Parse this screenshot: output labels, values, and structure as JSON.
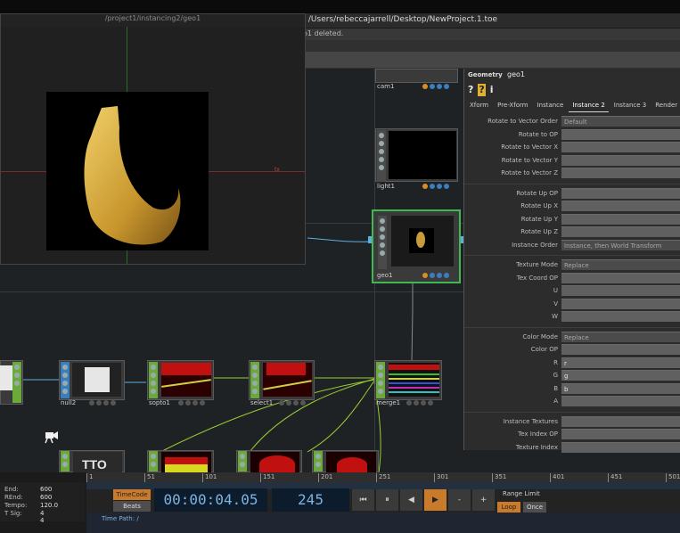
{
  "title_bar": {
    "path": ": /Users/rebeccajarrell/Desktop/NewProject.1.toe"
  },
  "message_bar": {
    "text": "o1 deleted."
  },
  "viewer": {
    "title": "/project1/instancing2/geo1",
    "axis_label": "tx"
  },
  "nodes": {
    "cam1": "cam1",
    "light1": "light1",
    "geo1": "geo1",
    "null2": "null2",
    "sopto1": "sopto1",
    "select1": "select1",
    "merge1": "merge1",
    "text_top": "TTO"
  },
  "params": {
    "op_type": "Geometry",
    "op_name": "geo1",
    "icons": [
      "?",
      "?",
      "i"
    ],
    "tabs": [
      "Xform",
      "Pre-Xform",
      "Instance",
      "Instance 2",
      "Instance 3",
      "Render",
      "E"
    ],
    "active_tab": "Instance 2",
    "rows": [
      {
        "label": "Rotate to Vector Order",
        "value": "Default",
        "dropdown": true
      },
      {
        "label": "Rotate to OP",
        "value": ""
      },
      {
        "label": "Rotate to Vector X",
        "value": ""
      },
      {
        "label": "Rotate to Vector Y",
        "value": ""
      },
      {
        "label": "Rotate to Vector Z",
        "value": ""
      },
      {
        "label": "Rotate Up OP",
        "value": ""
      },
      {
        "label": "Rotate Up X",
        "value": ""
      },
      {
        "label": "Rotate Up Y",
        "value": ""
      },
      {
        "label": "Rotate Up Z",
        "value": ""
      },
      {
        "label": "Instance Order",
        "value": "Instance, then World Transform",
        "dropdown": true
      },
      {
        "label": "Texture Mode",
        "value": "Replace",
        "dropdown": true
      },
      {
        "label": "Tex Coord OP",
        "value": ""
      },
      {
        "label": "U",
        "value": ""
      },
      {
        "label": "V",
        "value": ""
      },
      {
        "label": "W",
        "value": ""
      },
      {
        "label": "Color Mode",
        "value": "Replace",
        "dropdown": true
      },
      {
        "label": "Color OP",
        "value": ""
      },
      {
        "label": "R",
        "value": "r"
      },
      {
        "label": "G",
        "value": "g"
      },
      {
        "label": "B",
        "value": "b"
      },
      {
        "label": "A",
        "value": ""
      },
      {
        "label": "Instance Textures",
        "value": ""
      },
      {
        "label": "Tex Index OP",
        "value": ""
      },
      {
        "label": "Texture Index",
        "value": ""
      }
    ]
  },
  "timeline": {
    "ruler_ticks": [
      "1",
      "51",
      "101",
      "151",
      "201",
      "251",
      "301",
      "351",
      "401",
      "451",
      "501"
    ],
    "info": [
      {
        "label": "End:",
        "value": "600"
      },
      {
        "label": "REnd:",
        "value": "600"
      },
      {
        "label": "Tempo:",
        "value": "120.0"
      },
      {
        "label": "T Sig:",
        "value": "4      4"
      }
    ],
    "timecode_btn": "TimeCode",
    "beats_btn": "Beats",
    "timecode": "00:00:04.05",
    "frame": "245",
    "play_buttons": [
      "⏮",
      "⏸",
      "◀",
      "▶",
      "-",
      "+"
    ],
    "range_label": "Range Limit",
    "loop_btn": "Loop",
    "once_btn": "Once",
    "time_path": "Time Path: /"
  },
  "colors": {
    "accent": "#c97a2a",
    "timecode_text": "#7fb3dd",
    "geo_selected": "#3fb950",
    "chop_green": "#6aaa3a",
    "sop_blue": "#3a7ec0"
  }
}
